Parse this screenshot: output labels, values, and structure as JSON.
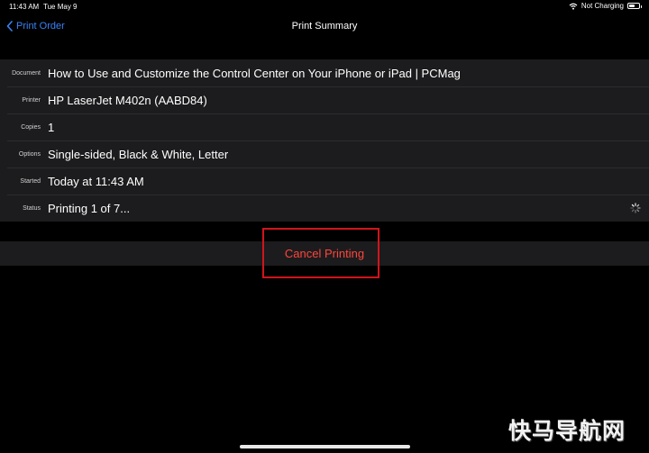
{
  "status_bar": {
    "time": "11:43 AM",
    "date": "Tue May 9",
    "charging_text": "Not Charging",
    "battery_level": 0.7,
    "icons": [
      "wifi-icon",
      "battery-icon"
    ]
  },
  "nav": {
    "back_label": "Print Order",
    "back_icon": "chevron-left-icon",
    "title": "Print Summary"
  },
  "summary_rows": [
    {
      "label": "Document",
      "value": "How to Use and Customize the Control Center on Your iPhone or iPad | PCMag"
    },
    {
      "label": "Printer",
      "value": "HP LaserJet M402n (AABD84)"
    },
    {
      "label": "Copies",
      "value": "1"
    },
    {
      "label": "Options",
      "value": "Single-sided, Black & White, Letter"
    },
    {
      "label": "Started",
      "value": "Today at 11:43 AM"
    },
    {
      "label": "Status",
      "value": "Printing 1 of 7...",
      "icon": "spinner-icon"
    }
  ],
  "actions": {
    "cancel_label": "Cancel Printing"
  },
  "watermark": "快马导航网",
  "colors": {
    "background": "#000000",
    "panel": "#1c1c1e",
    "accent": "#3b82f6",
    "destructive": "#ff453a",
    "highlight_box": "#d1141b"
  }
}
